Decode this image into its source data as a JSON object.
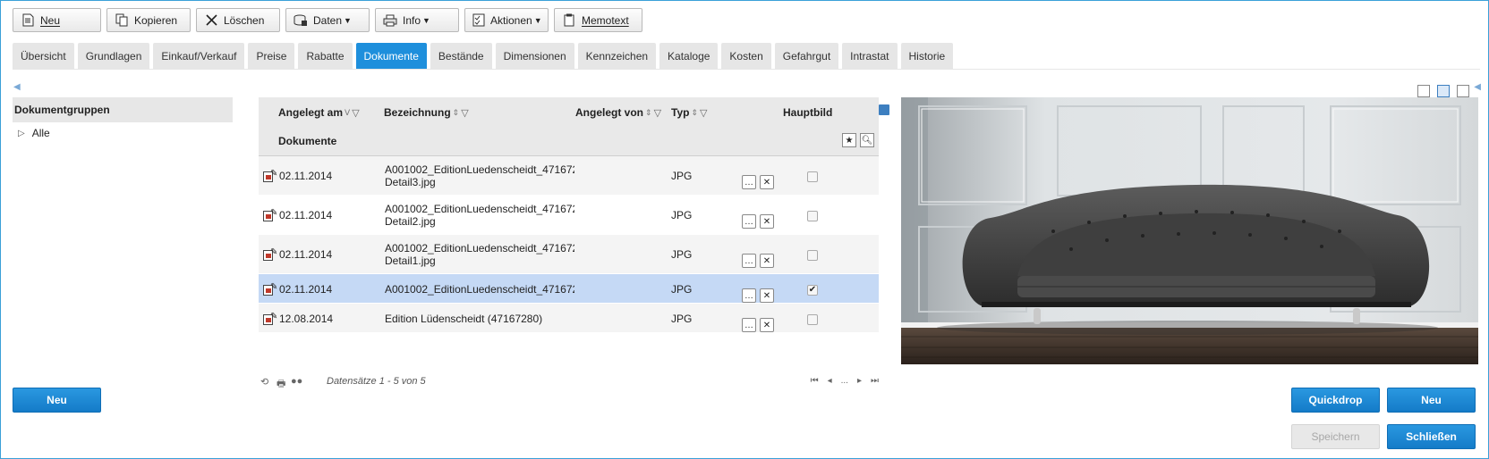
{
  "toolbar": [
    {
      "label": "Neu",
      "icon": "document-icon"
    },
    {
      "label": "Kopieren",
      "icon": "copy-icon"
    },
    {
      "label": "Löschen",
      "icon": "delete-icon"
    },
    {
      "label": "Daten",
      "icon": "database-icon",
      "dropdown": true
    },
    {
      "label": "Info",
      "icon": "printer-icon",
      "dropdown": true
    },
    {
      "label": "Aktionen",
      "icon": "checklist-icon",
      "dropdown": true
    },
    {
      "label": "Memotext",
      "icon": "clipboard-icon"
    }
  ],
  "tabs": [
    "Übersicht",
    "Grundlagen",
    "Einkauf/Verkauf",
    "Preise",
    "Rabatte",
    "Dokumente",
    "Bestände",
    "Dimensionen",
    "Kennzeichen",
    "Kataloge",
    "Kosten",
    "Gefahrgut",
    "Intrastat",
    "Historie"
  ],
  "active_tab": "Dokumente",
  "left_panel": {
    "title": "Dokumentgruppen",
    "items": [
      "Alle"
    ]
  },
  "grid": {
    "columns": {
      "angelegt_am": "Angelegt am",
      "bezeichnung": "Bezeichnung",
      "angelegt_von": "Angelegt von",
      "typ": "Typ",
      "hauptbild": "Hauptbild"
    },
    "group_label": "Dokumente",
    "rows": [
      {
        "date": "02.11.2014",
        "name_line1": "A001002_EditionLuedenscheidt_471672",
        "name_line2": "Detail3.jpg",
        "typ": "JPG",
        "hauptbild": false,
        "selected": false
      },
      {
        "date": "02.11.2014",
        "name_line1": "A001002_EditionLuedenscheidt_471672",
        "name_line2": "Detail2.jpg",
        "typ": "JPG",
        "hauptbild": false,
        "selected": false
      },
      {
        "date": "02.11.2014",
        "name_line1": "A001002_EditionLuedenscheidt_471672",
        "name_line2": "Detail1.jpg",
        "typ": "JPG",
        "hauptbild": false,
        "selected": false
      },
      {
        "date": "02.11.2014",
        "name_line1": "A001002_EditionLuedenscheidt_471672",
        "name_line2": "",
        "typ": "JPG",
        "hauptbild": true,
        "selected": true
      },
      {
        "date": "12.08.2014",
        "name_line1": "Edition Lüdenscheidt (47167280)",
        "name_line2": "",
        "typ": "JPG",
        "hauptbild": false,
        "selected": false
      }
    ],
    "footer_text": "Datensätze 1 - 5 von 5",
    "pager_ellipsis": "..."
  },
  "buttons": {
    "left_new": "Neu",
    "quickdrop": "Quickdrop",
    "right_new": "Neu",
    "save": "Speichern",
    "close": "Schließen"
  },
  "colors": {
    "accent": "#1e8fdc",
    "selected_row": "#c5d9f5"
  }
}
